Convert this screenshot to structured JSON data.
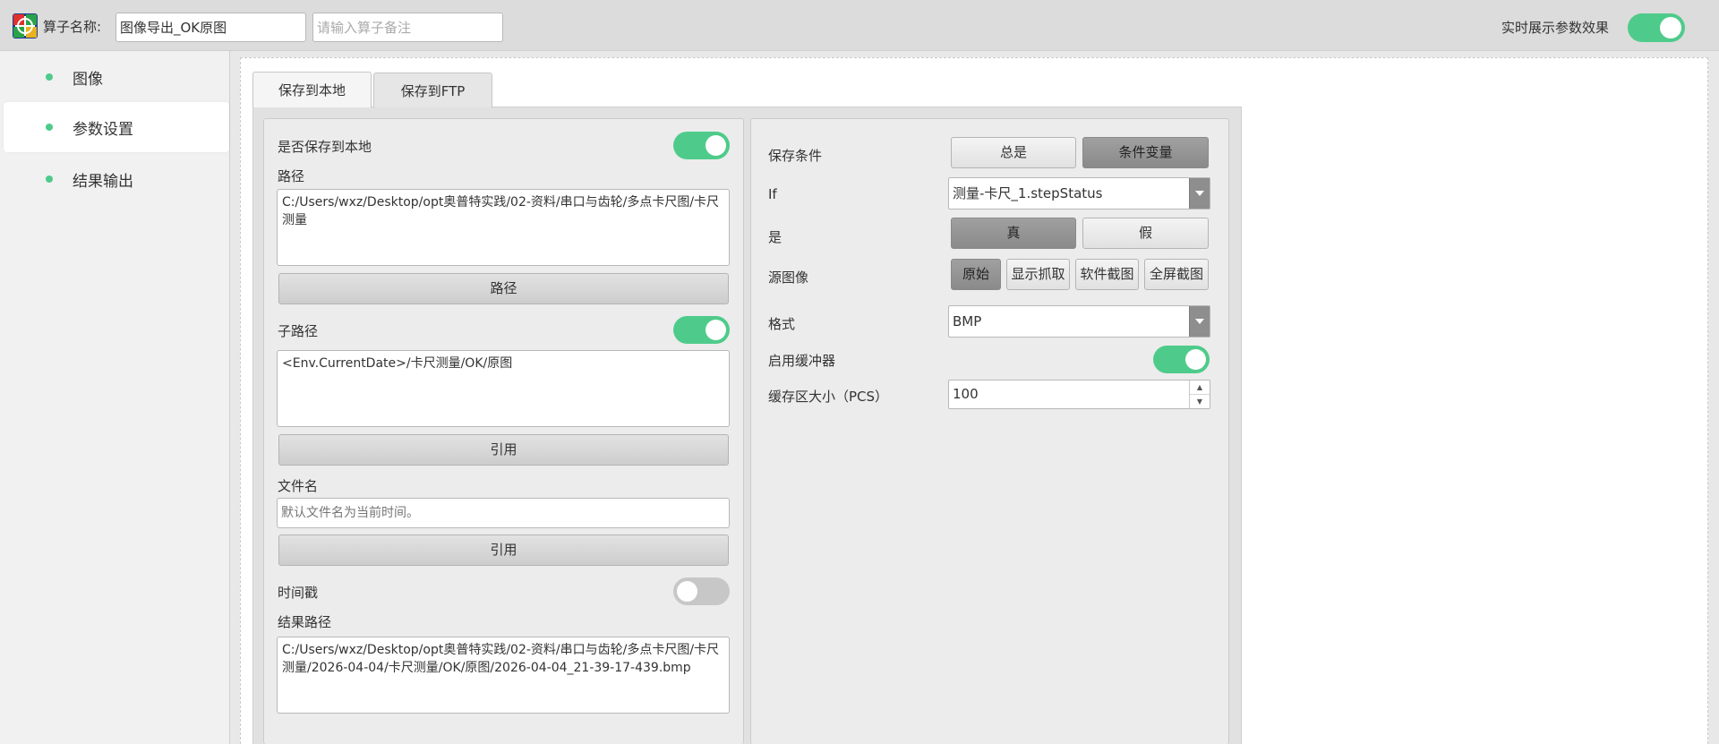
{
  "header": {
    "name_label": "算子名称:",
    "name_value": "图像导出_OK原图",
    "remark_placeholder": "请输入算子备注",
    "live_label": "实时展示参数效果",
    "live_on": true
  },
  "sidebar": {
    "items": [
      {
        "label": "图像",
        "active": false
      },
      {
        "label": "参数设置",
        "active": true
      },
      {
        "label": "结果输出",
        "active": false
      }
    ]
  },
  "tabs": [
    {
      "label": "保存到本地",
      "active": true
    },
    {
      "label": "保存到FTP",
      "active": false
    }
  ],
  "left": {
    "save_local_label": "是否保存到本地",
    "save_local_on": true,
    "path_label": "路径",
    "path_value": "C:/Users/wxz/Desktop/opt奥普特实践/02-资料/串口与齿轮/多点卡尺图/卡尺测量",
    "path_button": "路径",
    "subpath_label": "子路径",
    "subpath_on": true,
    "subpath_value": "<Env.CurrentDate>/卡尺测量/OK/原图",
    "subpath_button": "引用",
    "filename_label": "文件名",
    "filename_placeholder": "默认文件名为当前时间。",
    "filename_button": "引用",
    "timestamp_label": "时间戳",
    "timestamp_on": false,
    "result_path_label": "结果路径",
    "result_path_value": "C:/Users/wxz/Desktop/opt奥普特实践/02-资料/串口与齿轮/多点卡尺图/卡尺测量/2026-04-04/卡尺测量/OK/原图/2026-04-04_21-39-17-439.bmp"
  },
  "right": {
    "save_condition_label": "保存条件",
    "save_condition_options": [
      "总是",
      "条件变量"
    ],
    "save_condition_selected": "条件变量",
    "if_label": "If",
    "if_value": "测量-卡尺_1.stepStatus",
    "is_label": "是",
    "is_options": [
      "真",
      "假"
    ],
    "is_selected": "真",
    "source_label": "源图像",
    "source_options": [
      "原始",
      "显示抓取",
      "软件截图",
      "全屏截图"
    ],
    "source_selected": "原始",
    "format_label": "格式",
    "format_value": "BMP",
    "buffer_label": "启用缓冲器",
    "buffer_on": true,
    "buffer_size_label": "缓存区大小（PCS）",
    "buffer_size_value": "100"
  },
  "colors": {
    "accent": "#4ecb8a",
    "toggle_off": "#c7c7c7"
  },
  "icons": {
    "logo": "app-logo-icon",
    "dropdown": "chevron-down-icon",
    "spin": "spin-arrows-icon"
  }
}
